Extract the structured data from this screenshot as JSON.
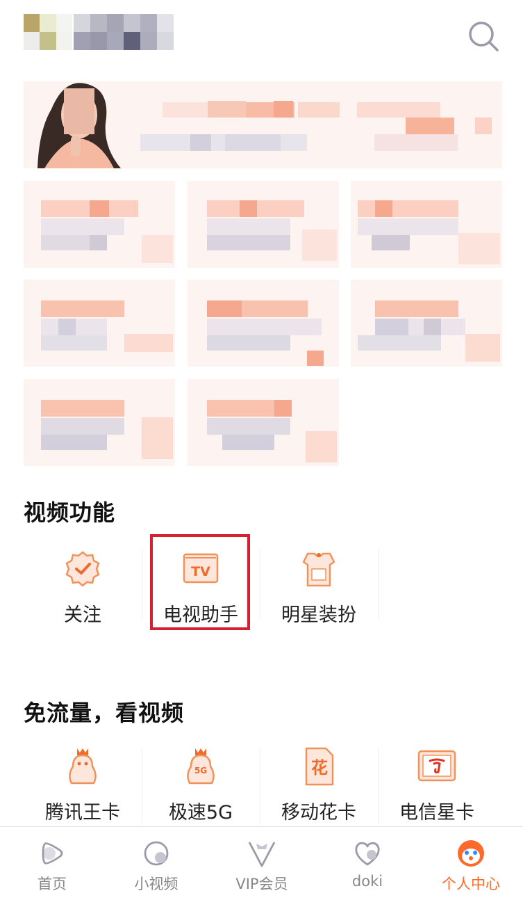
{
  "header": {
    "search_icon": "search-icon"
  },
  "sections": {
    "video_features": {
      "title": "视频功能",
      "items": [
        {
          "label": "关注",
          "icon": "follow-badge-icon"
        },
        {
          "label": "电视助手",
          "icon": "tv-icon"
        },
        {
          "label": "明星装扮",
          "icon": "star-outfit-icon"
        }
      ]
    },
    "free_data": {
      "title": "免流量，看视频",
      "items": [
        {
          "label": "腾讯王卡",
          "icon": "penguin-crown-icon"
        },
        {
          "label": "极速5G",
          "icon": "penguin-5g-icon"
        },
        {
          "label": "移动花卡",
          "icon": "flower-card-icon"
        },
        {
          "label": "电信星卡",
          "icon": "telecom-card-icon"
        }
      ]
    }
  },
  "tabbar": {
    "tabs": [
      {
        "label": "首页",
        "icon": "home-play-icon"
      },
      {
        "label": "小视频",
        "icon": "short-video-icon"
      },
      {
        "label": "VIP会员",
        "icon": "vip-icon"
      },
      {
        "label": "doki",
        "icon": "doki-heart-icon"
      },
      {
        "label": "个人中心",
        "icon": "profile-mascot-icon",
        "active": true
      }
    ]
  },
  "colors": {
    "accent": "#ff6a2a",
    "icon_orange": "#f0935a",
    "highlight_border": "#d42030"
  }
}
